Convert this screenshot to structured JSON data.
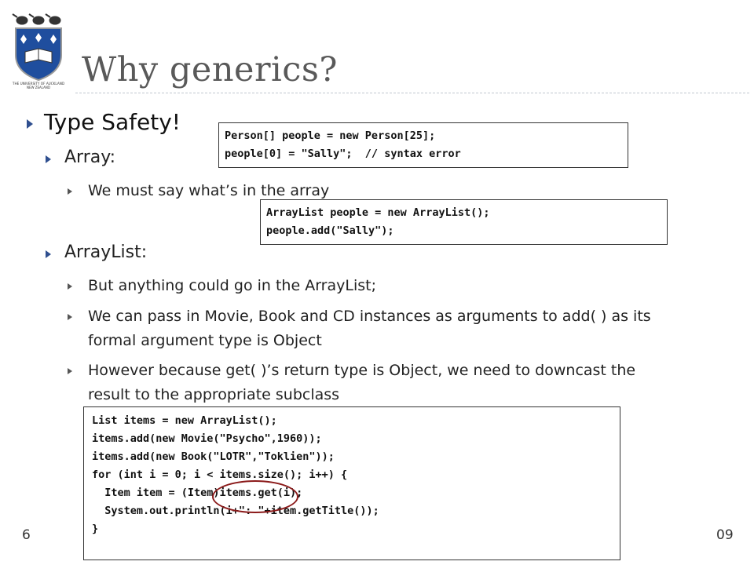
{
  "slide": {
    "title": "Why generics?",
    "page_number": "6",
    "footer_right": "09"
  },
  "bullets": {
    "type_safety": "Type Safety!",
    "array": "Array:",
    "array_sub": "We must say what’s in the array",
    "arraylist": "ArrayList:",
    "arraylist_sub1": "But anything could go in the ArrayList;",
    "arraylist_sub2_l1": "We can pass in Movie, Book and CD instances as arguments to add( ) as its",
    "arraylist_sub2_l2": "formal argument type is Object",
    "arraylist_sub3_l1": "However because get( )’s return type is Object, we need to downcast the",
    "arraylist_sub3_l2": "result to the appropriate subclass"
  },
  "code_boxes": {
    "array_code": [
      "Person[] people = new Person[25];",
      "people[0] = \"Sally\";  // syntax error"
    ],
    "arraylist_code": [
      "ArrayList people = new ArrayList();",
      "people.add(\"Sally\");"
    ],
    "list_code": [
      "List items = new ArrayList();",
      "items.add(new Movie(\"Psycho\",1960));",
      "items.add(new Book(\"LOTR\",\"Toklien\"));",
      "for (int i = 0; i < items.size(); i++) {",
      "  Item item = (Item)items.get(i);",
      "  System.out.println(i+\": \"+item.getTitle());",
      "}"
    ]
  },
  "colors": {
    "bullet": "#2f4f8f",
    "title": "#595959",
    "annotation_circle": "#8b1a1a"
  },
  "logo": {
    "icon": "university-crest-icon",
    "text_line1": "THE UNIVERSITY OF AUCKLAND",
    "text_line2": "NEW ZEALAND"
  }
}
